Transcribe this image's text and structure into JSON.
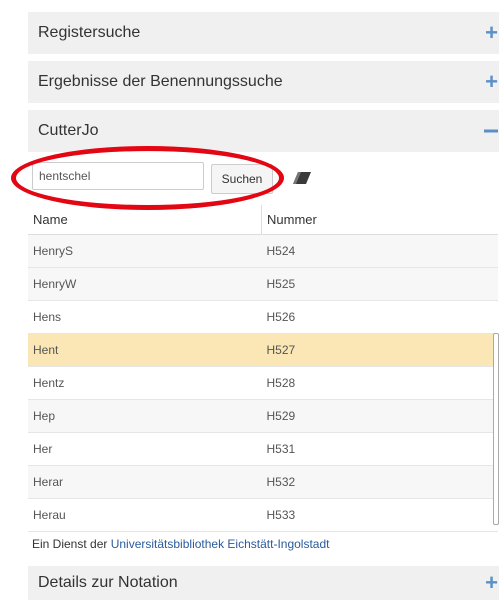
{
  "panels": {
    "register": {
      "title": "Registersuche",
      "icon": "plus-icon"
    },
    "benennung": {
      "title": "Ergebnisse der Benennungssuche",
      "icon": "plus-icon"
    },
    "cutterjo": {
      "title": "CutterJo",
      "icon": "minus-icon"
    },
    "details": {
      "title": "Details zur Notation",
      "icon": "plus-icon"
    }
  },
  "search": {
    "value": "hentschel",
    "button_label": "Suchen",
    "clear_icon": "eraser-icon"
  },
  "table": {
    "columns": [
      "Name",
      "Nummer"
    ],
    "rows": [
      {
        "name": "HenryS",
        "nummer": "H524"
      },
      {
        "name": "HenryW",
        "nummer": "H525"
      },
      {
        "name": "Hens",
        "nummer": "H526"
      },
      {
        "name": "Hent",
        "nummer": "H527",
        "selected": true
      },
      {
        "name": "Hentz",
        "nummer": "H528"
      },
      {
        "name": "Hep",
        "nummer": "H529"
      },
      {
        "name": "Her",
        "nummer": "H531"
      },
      {
        "name": "Herar",
        "nummer": "H532"
      },
      {
        "name": "Herau",
        "nummer": "H533"
      }
    ]
  },
  "footer": {
    "prefix": "Ein Dienst der ",
    "link": "Universitätsbibliothek Eichstätt-Ingolstadt"
  },
  "colors": {
    "accent": "#5b8fc7",
    "selected_row": "#fbe7b5",
    "annotation": "#e30613",
    "link": "#2a5b9c"
  }
}
